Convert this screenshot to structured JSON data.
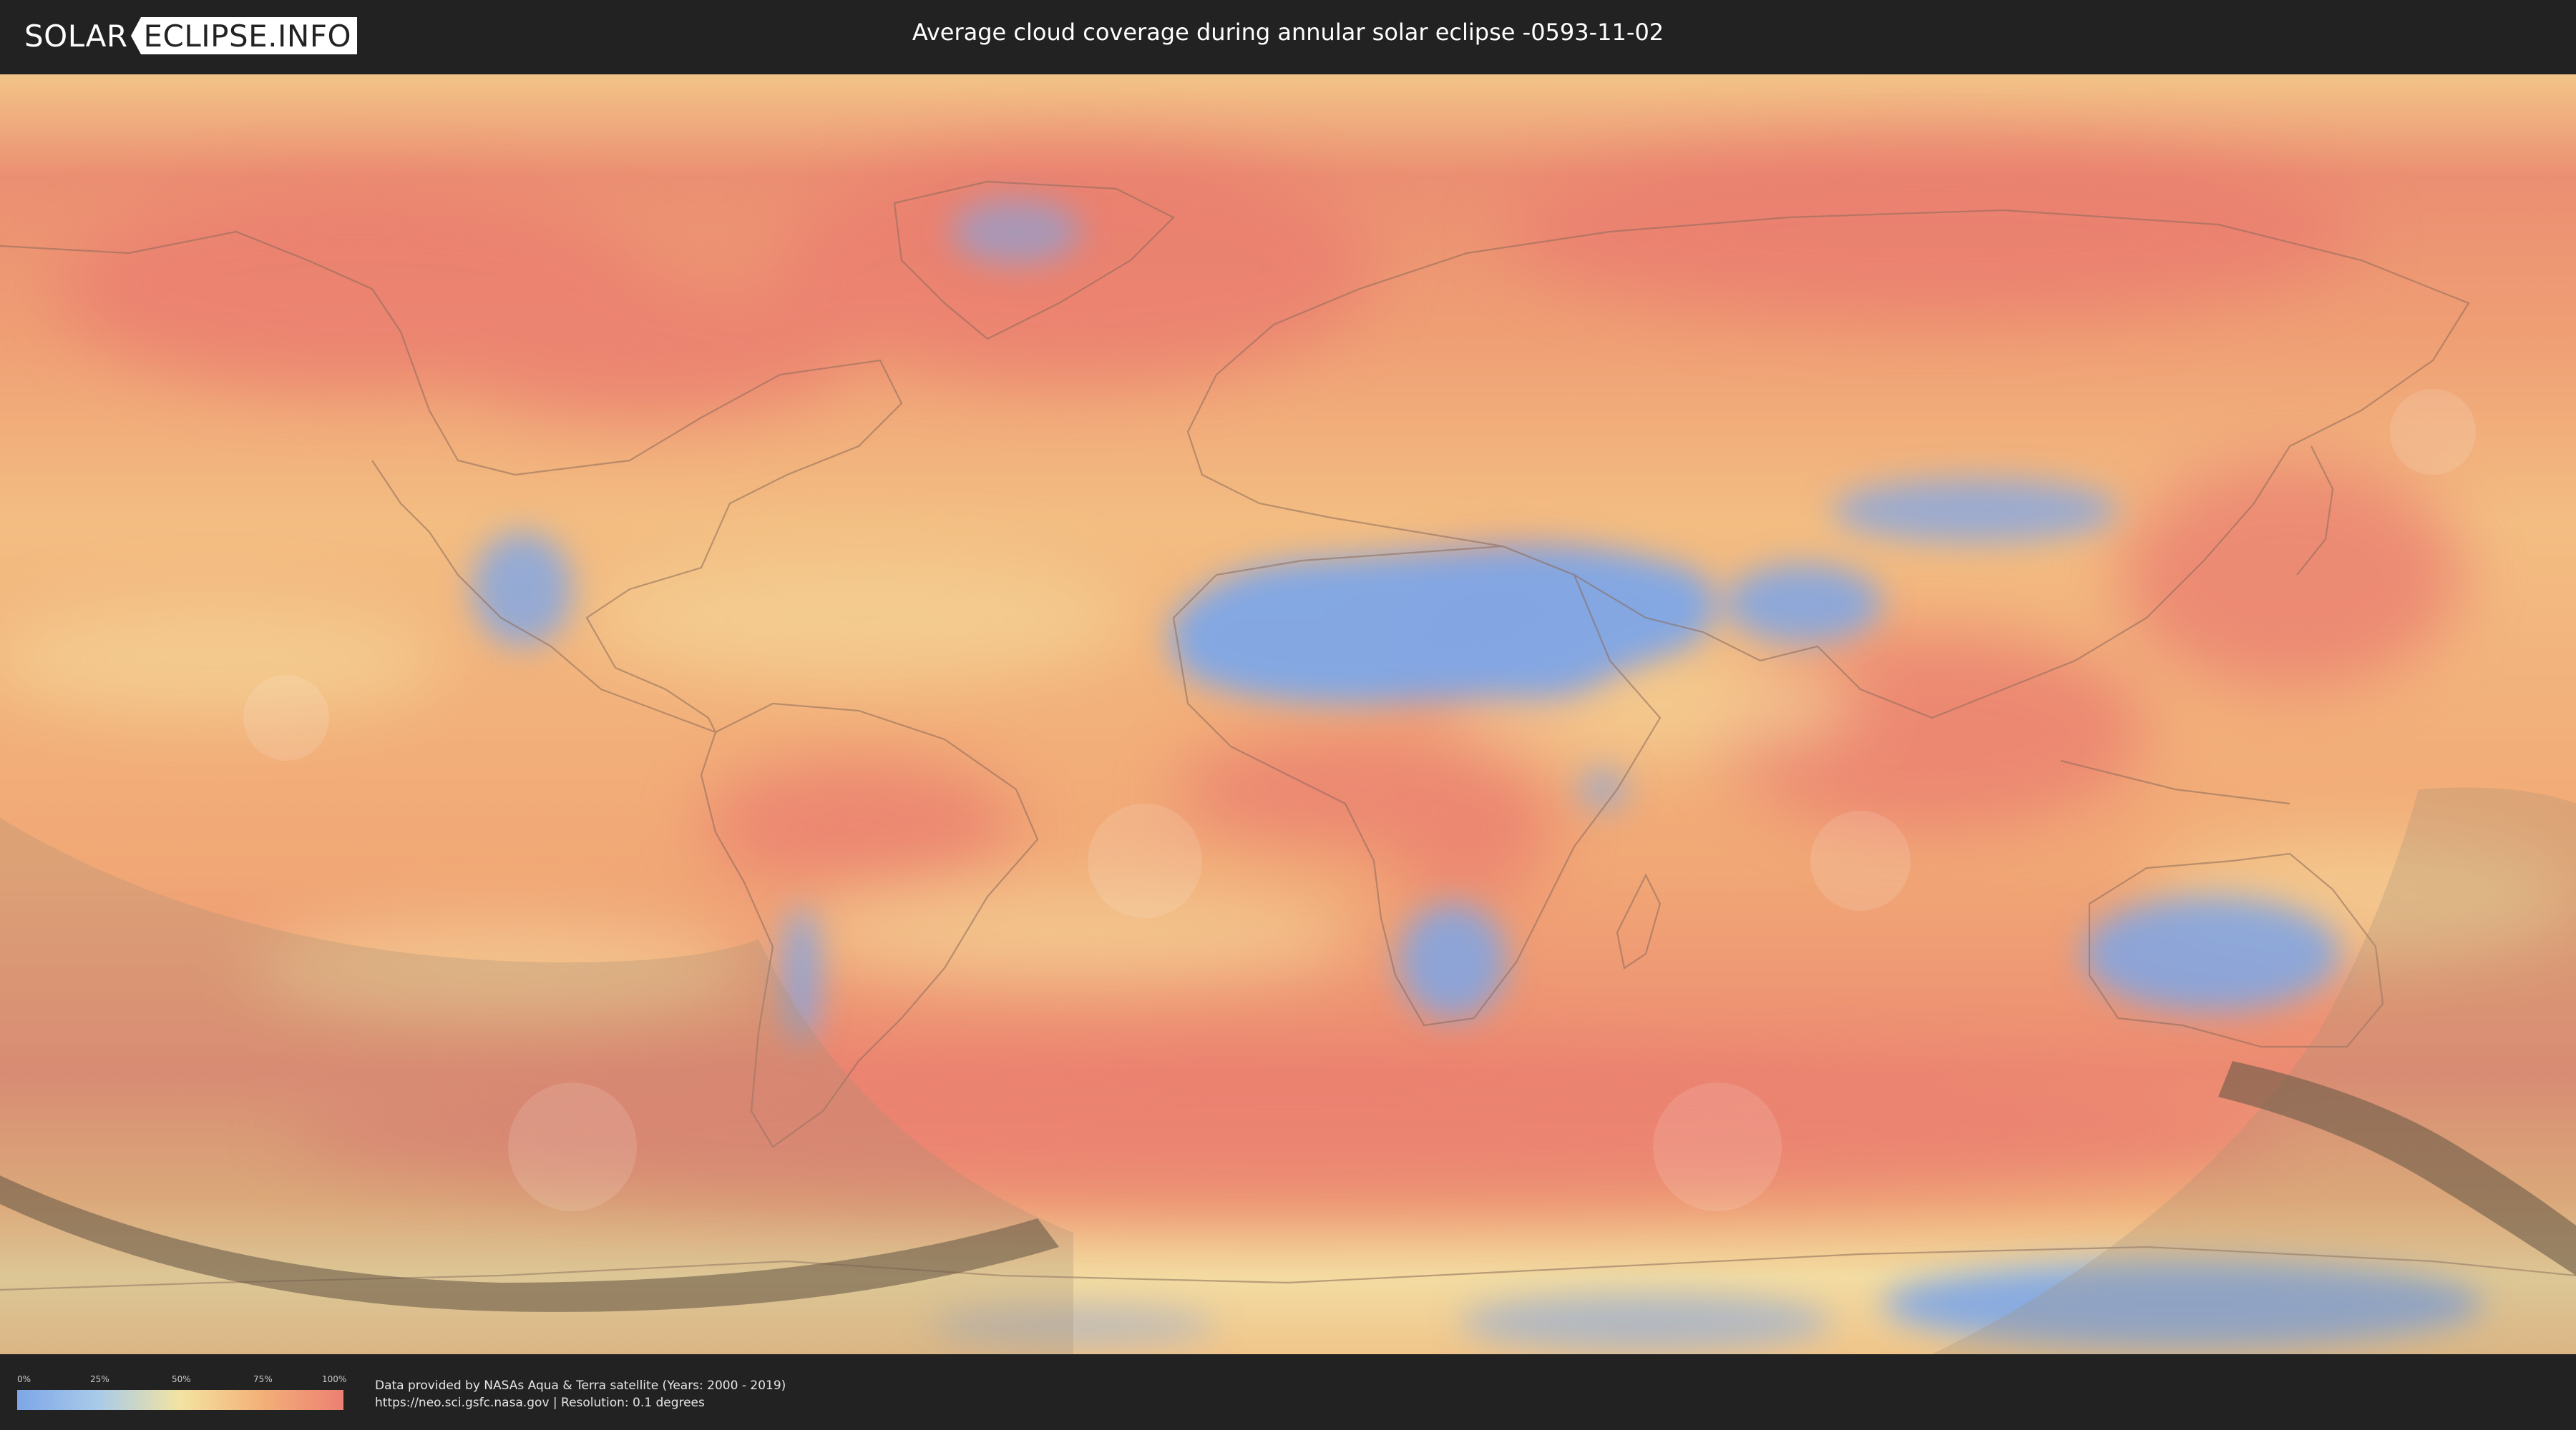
{
  "header": {
    "logo_left": "SOLAR",
    "logo_right": "ECLIPSE.INFO",
    "title": "Average cloud coverage during annular solar eclipse -0593-11-02"
  },
  "map": {
    "base_color": "#f1ae78",
    "colors": {
      "clear": "#7da6e8",
      "light": "#a9cbe8",
      "medium": "#f3e3a1",
      "heavy": "#f3b078",
      "overcast": "#ec7f72",
      "shadow_zone": "#c9a57a",
      "eclipse_path": "#6b5a48"
    }
  },
  "legend": {
    "ticks": [
      "0%",
      "25%",
      "50%",
      "75%",
      "100%"
    ]
  },
  "footer": {
    "credit_line1": "Data provided by NASAs Aqua & Terra satellite (Years: 2000 - 2019)",
    "credit_line2": "https://neo.sci.gsfc.nasa.gov | Resolution: 0.1 degrees"
  }
}
